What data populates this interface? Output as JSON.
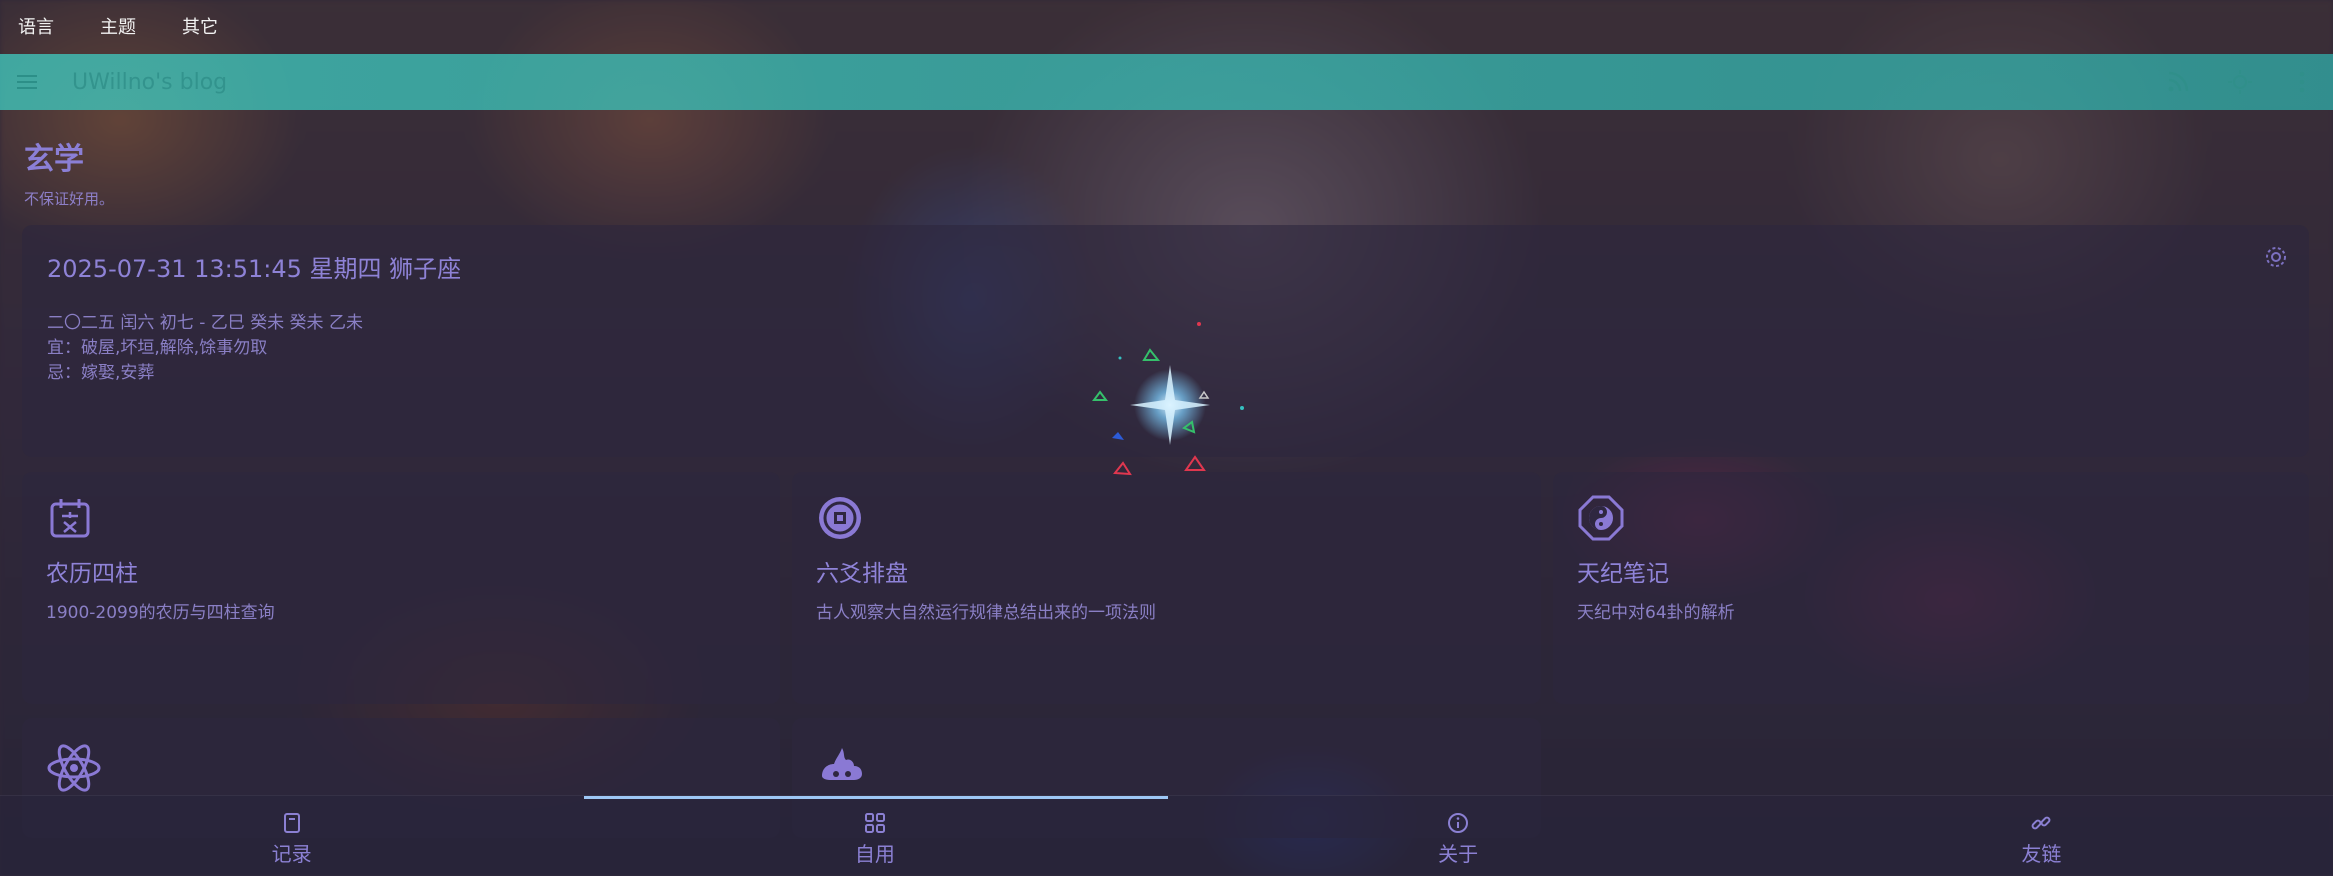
{
  "top_menu": {
    "language": "语言",
    "theme": "主题",
    "other": "其它"
  },
  "appbar": {
    "title": "UWillno's blog"
  },
  "page": {
    "title": "玄学",
    "subtitle": "不保证好用。"
  },
  "calendar": {
    "datetime": "2025-07-31 13:51:45 星期四 狮子座",
    "lunar": "二〇二五 闰六 初七 - 乙巳 癸未 癸未 乙未",
    "good": "宜：破屋,坏垣,解除,馀事勿取",
    "bad": "忌：嫁娶,安葬"
  },
  "tiles": [
    {
      "title": "农历四柱",
      "desc": "1900-2099的农历与四柱查询",
      "icon": "calendar-nong-icon"
    },
    {
      "title": "六爻排盘",
      "desc": "古人观察大自然运行规律总结出来的一项法则",
      "icon": "coin-icon"
    },
    {
      "title": "天纪笔记",
      "desc": "天纪中对64卦的解析",
      "icon": "yinyang-icon"
    },
    {
      "title": "",
      "desc": "",
      "icon": "atom-icon"
    },
    {
      "title": "",
      "desc": "",
      "icon": "incense-burner-icon"
    }
  ],
  "bottom_nav": [
    {
      "label": "记录",
      "icon": "book-icon"
    },
    {
      "label": "自用",
      "icon": "grid-icon"
    },
    {
      "label": "关于",
      "icon": "info-icon"
    },
    {
      "label": "友链",
      "icon": "link-icon"
    }
  ],
  "colors": {
    "appbar": "#40c8be",
    "accent": "#8b7fd6",
    "nav_indicator": "#9ec7f5"
  }
}
